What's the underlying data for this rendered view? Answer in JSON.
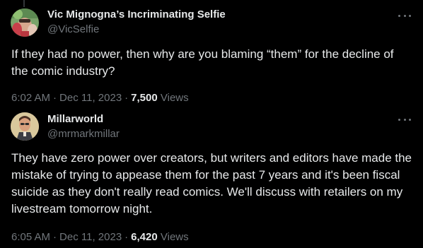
{
  "tweets": [
    {
      "display_name": "Vic Mignogna’s Incriminating Selfie",
      "handle": "@VicSelfie",
      "text": "If they had no power, then why are you blaming “them” for the decline of the comic industry?",
      "time": "6:02 AM",
      "date": "Dec 11, 2023",
      "views_count": "7,500",
      "views_label": "Views",
      "more_icon": "more-dots-icon"
    },
    {
      "display_name": "Millarworld",
      "handle": "@mrmarkmillar",
      "text": "They have zero power over creators, but writers and editors have made the mistake of trying to appease them for the past 7 years and it's been fiscal suicide as they don't really read comics. We'll discuss with retailers on my livestream tomorrow night.",
      "time": "6:05 AM",
      "date": "Dec 11, 2023",
      "views_count": "6,420",
      "views_label": "Views",
      "more_icon": "more-dots-icon"
    }
  ],
  "colors": {
    "background": "#000000",
    "primary_text": "#e7e9ea",
    "secondary_text": "#71767b",
    "thread_line": "#333639"
  }
}
